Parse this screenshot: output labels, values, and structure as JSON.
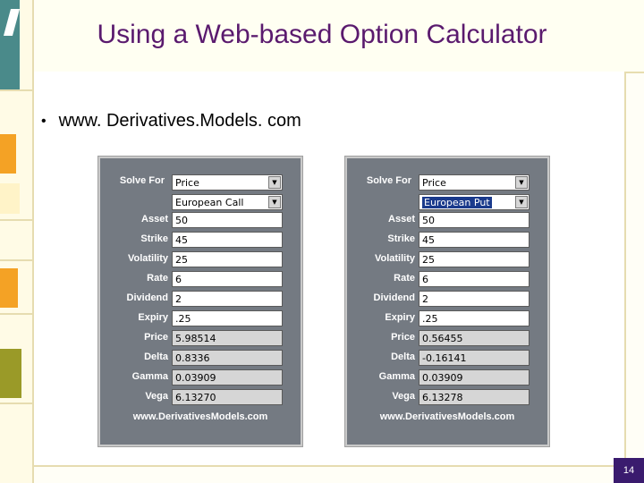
{
  "slide": {
    "title": "Using a Web-based Option Calculator",
    "bullet": "www. Derivatives.Models. com",
    "page_number": "14"
  },
  "calculators": [
    {
      "solve_for_label": "Solve For",
      "solve_for_value": "Price",
      "option_type": "European Call",
      "fields": [
        {
          "label": "Asset",
          "value": "50"
        },
        {
          "label": "Strike",
          "value": "45"
        },
        {
          "label": "Volatility",
          "value": "25"
        },
        {
          "label": "Rate",
          "value": "6"
        },
        {
          "label": "Dividend",
          "value": "2"
        },
        {
          "label": "Expiry",
          "value": ".25"
        }
      ],
      "outputs": [
        {
          "label": "Price",
          "value": "5.98514"
        },
        {
          "label": "Delta",
          "value": "0.8336"
        },
        {
          "label": "Gamma",
          "value": "0.03909"
        },
        {
          "label": "Vega",
          "value": "6.13270"
        }
      ],
      "footer": "www.DerivativesModels.com"
    },
    {
      "solve_for_label": "Solve For",
      "solve_for_value": "Price",
      "option_type": "European Put",
      "fields": [
        {
          "label": "Asset",
          "value": "50"
        },
        {
          "label": "Strike",
          "value": "45"
        },
        {
          "label": "Volatility",
          "value": "25"
        },
        {
          "label": "Rate",
          "value": "6"
        },
        {
          "label": "Dividend",
          "value": "2"
        },
        {
          "label": "Expiry",
          "value": ".25"
        }
      ],
      "outputs": [
        {
          "label": "Price",
          "value": "0.56455"
        },
        {
          "label": "Delta",
          "value": "-0.16141"
        },
        {
          "label": "Gamma",
          "value": "0.03909"
        },
        {
          "label": "Vega",
          "value": "6.13278"
        }
      ],
      "footer": "www.DerivativesModels.com"
    }
  ],
  "colors": {
    "title": "#5a1a6e",
    "panel_bg": "#747a82",
    "accent_orange": "#f4a225",
    "accent_teal": "#4a8a8a",
    "accent_olive": "#9a9a28",
    "page_badge": "#3a1b6e"
  }
}
